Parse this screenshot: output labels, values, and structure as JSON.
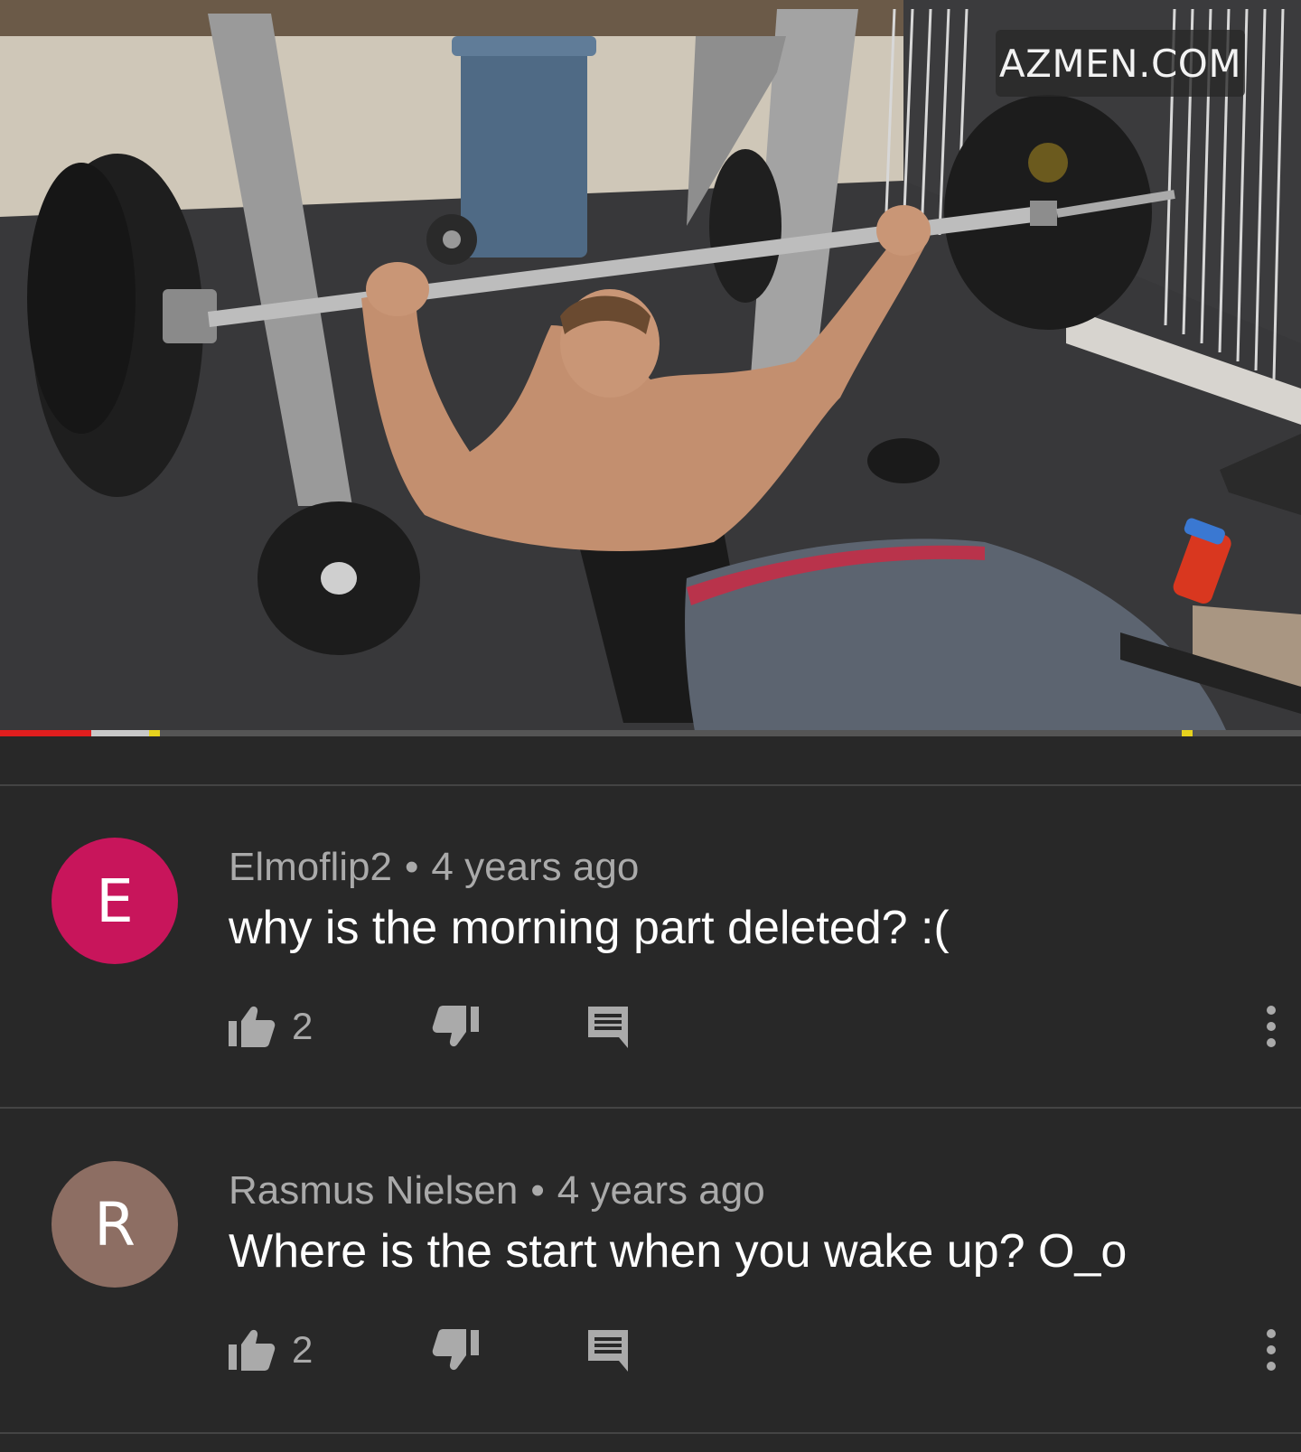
{
  "video": {
    "watermark": "AZMEN.COM",
    "progress": {
      "played_fraction": 0.07,
      "buffered_fraction": 0.115
    }
  },
  "comments": [
    {
      "avatar_letter": "E",
      "avatar_color": "#c8155b",
      "author": "Elmoflip2",
      "separator": "•",
      "time": "4 years ago",
      "text": "why is the morning part deleted? :(",
      "likes": "2",
      "icons": [
        "thumbs-up-icon",
        "thumbs-down-icon",
        "reply-icon",
        "more-vert-icon"
      ]
    },
    {
      "avatar_letter": "R",
      "avatar_color": "#8d6e63",
      "author": "Rasmus Nielsen",
      "separator": "•",
      "time": "4 years ago",
      "text": "Where is the start when you wake up? O_o",
      "likes": "2",
      "icons": [
        "thumbs-up-icon",
        "thumbs-down-icon",
        "reply-icon",
        "more-vert-icon"
      ]
    }
  ],
  "colors": {
    "background": "#282828",
    "meta_text": "#aaaaaa",
    "comment_text": "#ffffff",
    "progress_played": "#e01e1e"
  }
}
